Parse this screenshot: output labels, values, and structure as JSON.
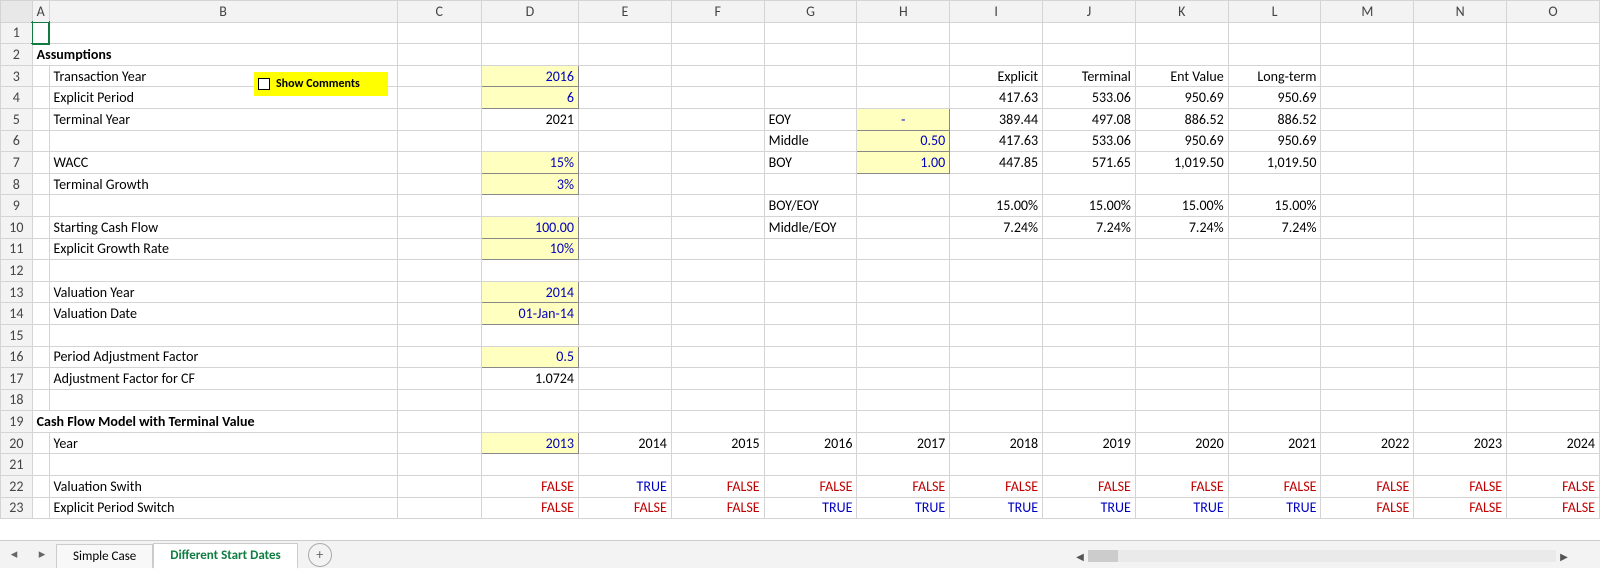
{
  "columns": [
    "A",
    "B",
    "C",
    "D",
    "E",
    "F",
    "G",
    "H",
    "I",
    "J",
    "K",
    "L",
    "M",
    "N",
    "O"
  ],
  "rowcount": 23,
  "show_comments_label": "Show Comments",
  "sections": {
    "assumptions": "Assumptions",
    "cfmodel": "Cash Flow Model with Terminal Value"
  },
  "labels": {
    "transaction_year": "Transaction Year",
    "explicit_period": "Explicit Period",
    "terminal_year": "Terminal Year",
    "wacc": "WACC",
    "terminal_growth": "Terminal Growth",
    "starting_cf": "Starting Cash Flow",
    "explicit_growth": "Explicit Growth Rate",
    "valuation_year": "Valuation Year",
    "valuation_date": "Valuation Date",
    "paf": "Period Adjustment Factor",
    "paf_cf": "Adjustment Factor for CF",
    "year": "Year",
    "val_switch": "Valuation Swith",
    "explicit_switch": "Explicit Period Switch"
  },
  "vals": {
    "transaction_year": "2016",
    "explicit_period": "6",
    "terminal_year": "2021",
    "wacc": "15%",
    "terminal_growth": "3%",
    "starting_cf": "100.00",
    "explicit_growth": "10%",
    "valuation_year": "2014",
    "valuation_date": "01-Jan-14",
    "paf": "0.5",
    "paf_cf": "1.0724",
    "year_d": "2013"
  },
  "right_headers": {
    "explicit": "Explicit",
    "terminal": "Terminal",
    "entvalue": "Ent Value",
    "longterm": "Long-term",
    "eoy": "EOY",
    "middle": "Middle",
    "boy": "BOY",
    "boy_eoy": "BOY/EOY",
    "mid_eoy": "Middle/EOY"
  },
  "right_table": {
    "row1": {
      "i": "417.63",
      "j": "533.06",
      "k": "950.69",
      "l": "950.69"
    },
    "eoy_i": "-",
    "row_eoy": {
      "i": "389.44",
      "j": "497.08",
      "k": "886.52",
      "l": "886.52"
    },
    "mid_i": "0.50",
    "row_mid": {
      "i": "417.63",
      "j": "533.06",
      "k": "950.69",
      "l": "950.69"
    },
    "boy_i": "1.00",
    "row_boy": {
      "i": "447.85",
      "j": "571.65",
      "k": "1,019.50",
      "l": "1,019.50"
    },
    "row_boyeoy": {
      "i": "15.00%",
      "j": "15.00%",
      "k": "15.00%",
      "l": "15.00%"
    },
    "row_mideoy": {
      "i": "7.24%",
      "j": "7.24%",
      "k": "7.24%",
      "l": "7.24%"
    }
  },
  "years_row": [
    "2014",
    "2015",
    "2016",
    "2017",
    "2018",
    "2019",
    "2020",
    "2021",
    "2022",
    "2023",
    "2024"
  ],
  "val_switch_row": [
    "FALSE",
    "TRUE",
    "FALSE",
    "FALSE",
    "FALSE",
    "FALSE",
    "FALSE",
    "FALSE",
    "FALSE",
    "FALSE",
    "FALSE",
    "FALSE"
  ],
  "explicit_switch_row": [
    "FALSE",
    "FALSE",
    "FALSE",
    "TRUE",
    "TRUE",
    "TRUE",
    "TRUE",
    "TRUE",
    "TRUE",
    "FALSE",
    "FALSE",
    "FALSE"
  ],
  "tabs": {
    "simple": "Simple Case",
    "diff": "Different Start Dates"
  },
  "colors": {
    "input_bg": "#ffffc0",
    "blue": "#0000c0",
    "red": "#c00000",
    "accent": "#107c41",
    "highlight": "#ffff00"
  }
}
